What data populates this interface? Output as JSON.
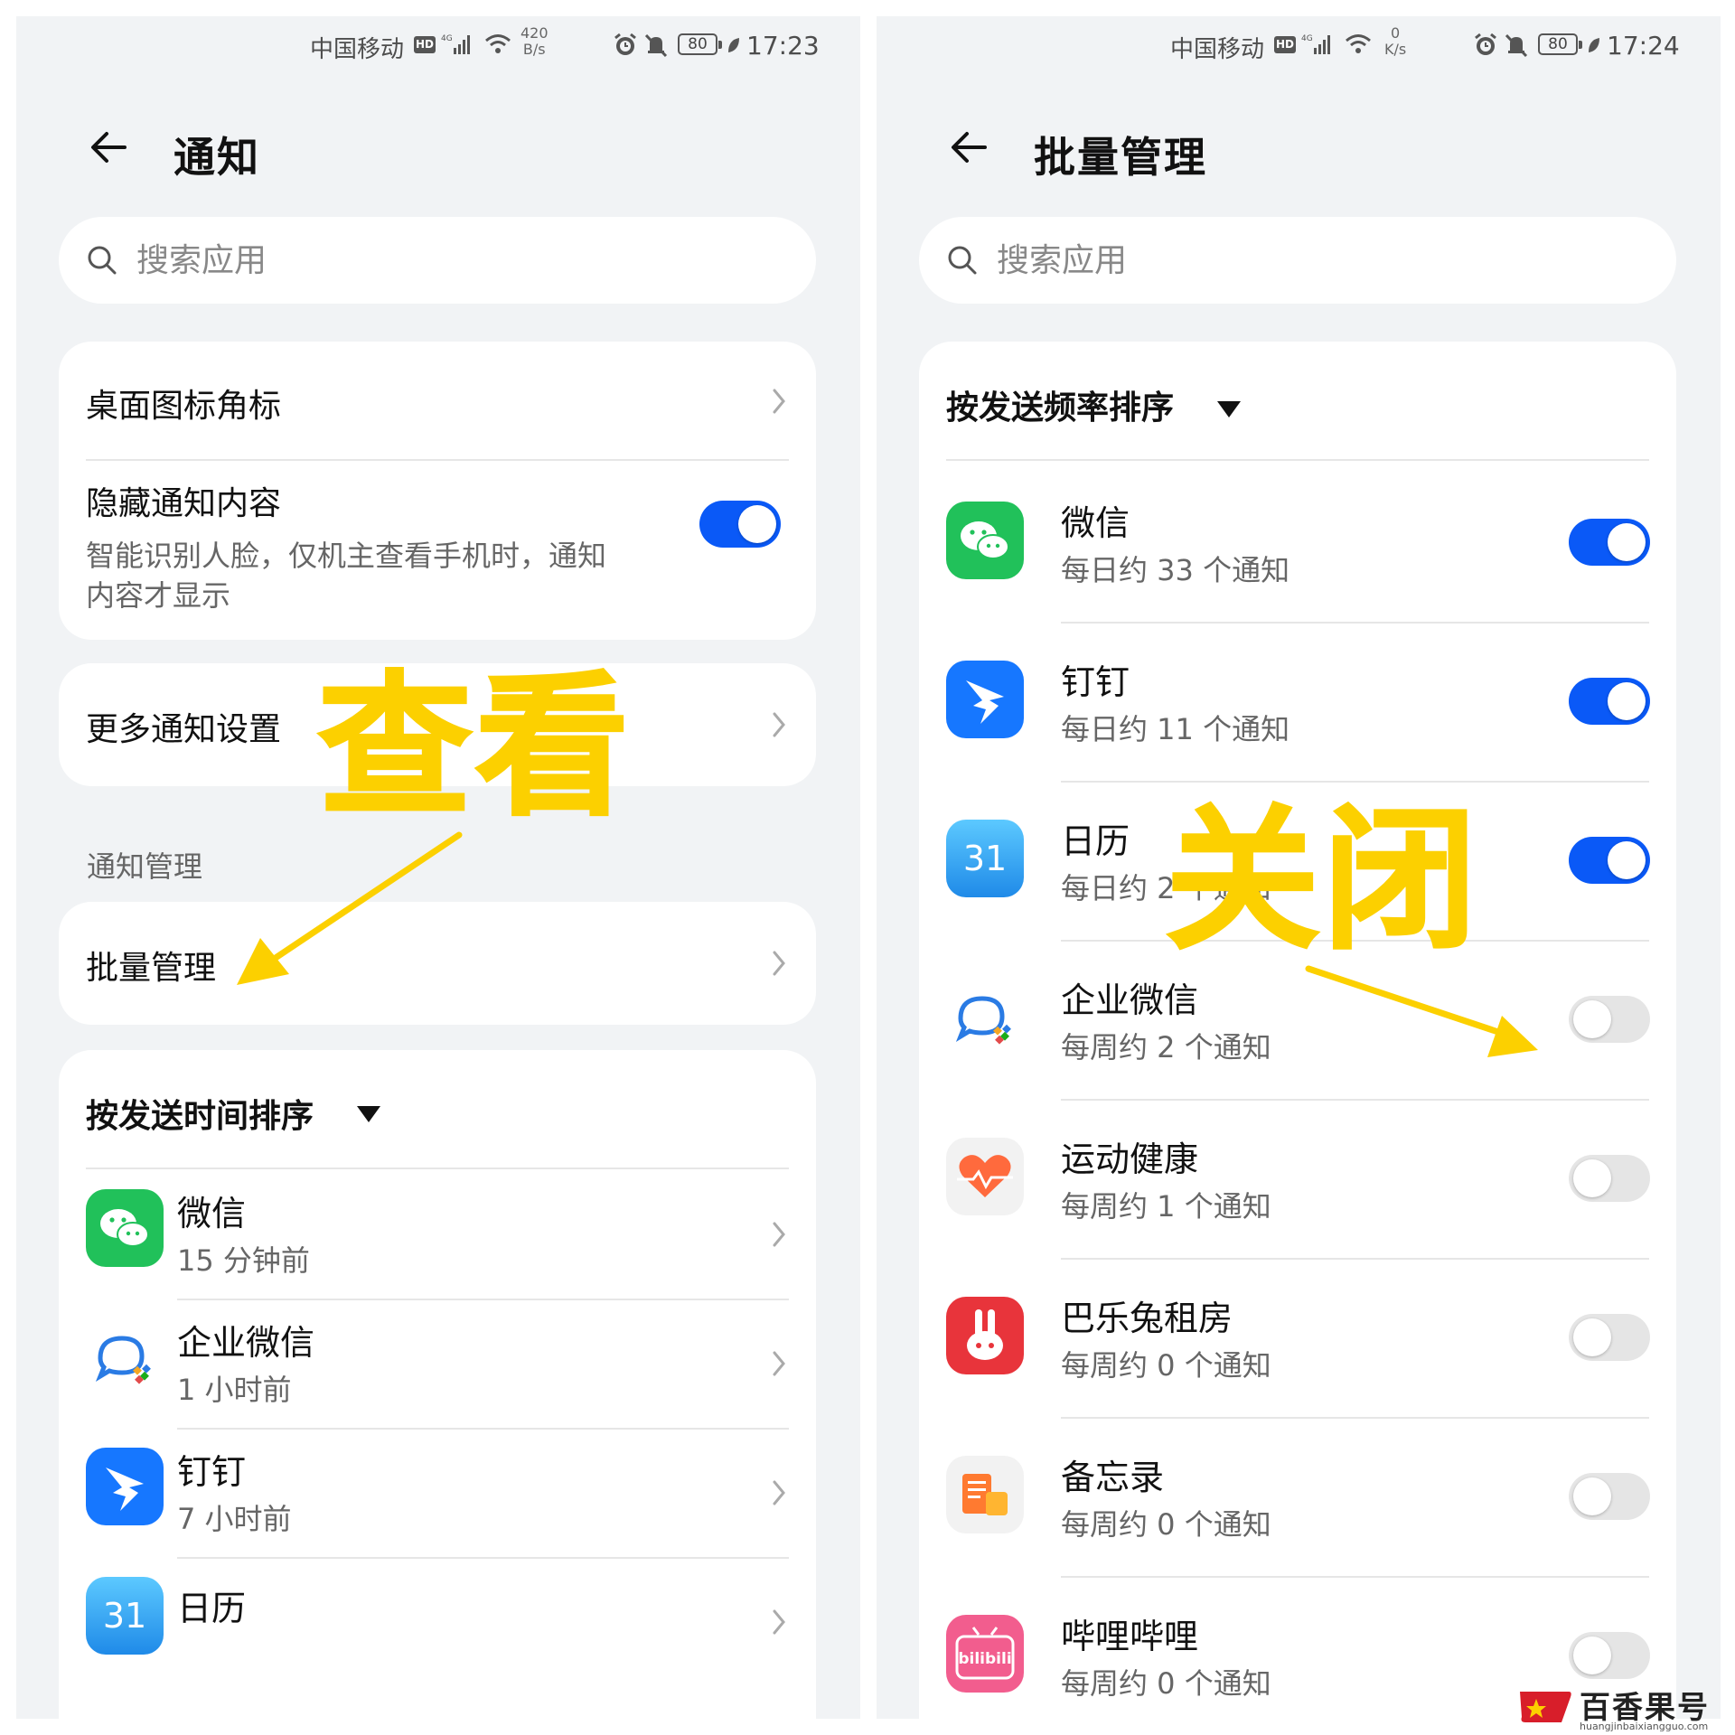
{
  "left": {
    "status": {
      "carrier": "中国移动",
      "hd": "HD",
      "signal_tag": "4G",
      "speed_value": "420",
      "speed_unit": "B/s",
      "battery": "80",
      "time": "17:23"
    },
    "title": "通知",
    "search_placeholder": "搜索应用",
    "settings": {
      "badge_label": "桌面图标角标",
      "hide_label": "隐藏通知内容",
      "hide_desc_line1": "智能识别人脸，仅机主查看手机时，通知",
      "hide_desc_line2": "内容才显示",
      "hide_enabled": true,
      "more_label": "更多通知设置"
    },
    "section_label": "通知管理",
    "batch_label": "批量管理",
    "sort_label": "按发送时间排序",
    "apps": [
      {
        "name": "微信",
        "sub": "15 分钟前",
        "icon": "wechat-icon"
      },
      {
        "name": "企业微信",
        "sub": "1 小时前",
        "icon": "wecom-icon"
      },
      {
        "name": "钉钉",
        "sub": "7 小时前",
        "icon": "dingtalk-icon"
      },
      {
        "name": "日历",
        "sub": "",
        "icon": "calendar-icon"
      }
    ]
  },
  "right": {
    "status": {
      "carrier": "中国移动",
      "hd": "HD",
      "signal_tag": "4G",
      "speed_value": "0",
      "speed_unit": "K/s",
      "battery": "80",
      "time": "17:24"
    },
    "title": "批量管理",
    "search_placeholder": "搜索应用",
    "sort_label": "按发送频率排序",
    "apps": [
      {
        "name": "微信",
        "sub": "每日约 33 个通知",
        "enabled": true,
        "icon": "wechat-icon"
      },
      {
        "name": "钉钉",
        "sub": "每日约 11 个通知",
        "enabled": true,
        "icon": "dingtalk-icon"
      },
      {
        "name": "日历",
        "sub": "每日约 2 个通知",
        "enabled": true,
        "icon": "calendar-icon"
      },
      {
        "name": "企业微信",
        "sub": "每周约 2 个通知",
        "enabled": false,
        "icon": "wecom-icon"
      },
      {
        "name": "运动健康",
        "sub": "每周约 1 个通知",
        "enabled": false,
        "icon": "health-icon"
      },
      {
        "name": "巴乐兔租房",
        "sub": "每周约 0 个通知",
        "enabled": false,
        "icon": "baletu-icon"
      },
      {
        "name": "备忘录",
        "sub": "每周约 0 个通知",
        "enabled": false,
        "icon": "notes-icon"
      },
      {
        "name": "哔哩哔哩",
        "sub": "每周约 0 个通知",
        "enabled": false,
        "icon": "bilibili-icon"
      }
    ]
  },
  "annotations": {
    "view": "查看",
    "close": "关闭"
  },
  "calendar_day": "31",
  "bilibili_logo_text": "bilibili",
  "watermark": {
    "name": "百香果号",
    "url": "huangjinbaixiangguo.com"
  },
  "colors": {
    "accent": "#0a59f7",
    "annotation": "#fcd000",
    "background": "#f1f3f5"
  }
}
